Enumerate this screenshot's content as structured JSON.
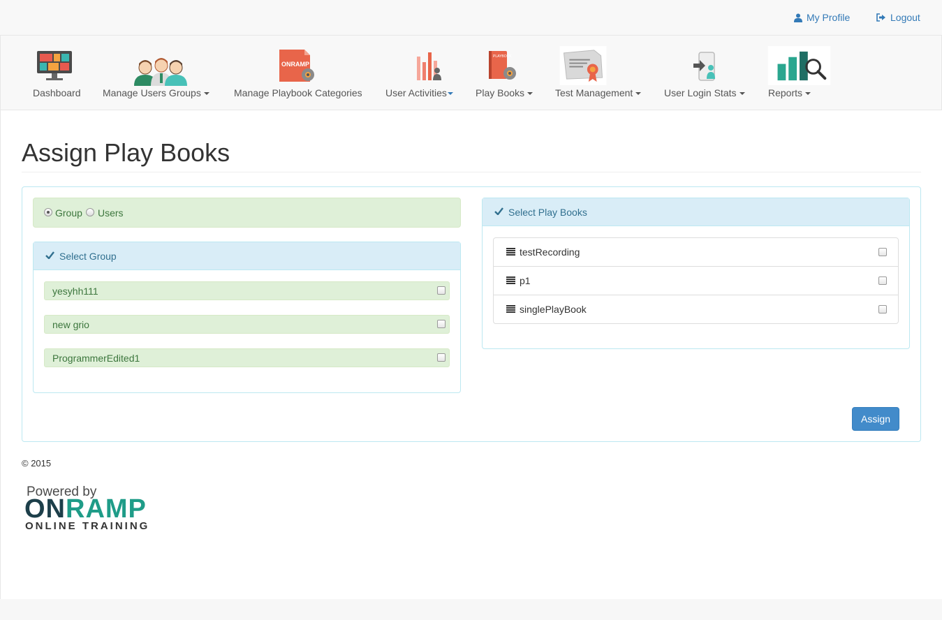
{
  "header": {
    "my_profile": "My Profile",
    "logout": "Logout"
  },
  "nav": {
    "items": [
      {
        "label": "Dashboard",
        "icon": "dashboard-monitor-icon",
        "has_caret": false
      },
      {
        "label": "Manage Users Groups",
        "icon": "users-group-icon",
        "has_caret": true
      },
      {
        "label": "Manage Playbook Categories",
        "icon": "onramp-settings-icon",
        "has_caret": false
      },
      {
        "label": "User Activities",
        "icon": "activity-bars-icon",
        "has_caret": true
      },
      {
        "label": "Play Books",
        "icon": "playbook-settings-icon",
        "has_caret": true
      },
      {
        "label": "Test Management",
        "icon": "certificate-icon",
        "has_caret": true
      },
      {
        "label": "User Login Stats",
        "icon": "login-stats-icon",
        "has_caret": true
      },
      {
        "label": "Reports",
        "icon": "reports-search-icon",
        "has_caret": true
      }
    ]
  },
  "page": {
    "title": "Assign Play Books"
  },
  "assign_type": {
    "options": [
      "Group",
      "Users"
    ],
    "selected": "Group"
  },
  "select_group": {
    "heading": "Select Group",
    "groups": [
      "yesyhh111",
      "new grio",
      "ProgrammerEdited1"
    ]
  },
  "select_playbooks": {
    "heading": "Select Play Books",
    "playbooks": [
      "testRecording",
      "p1",
      "singlePlayBook"
    ]
  },
  "actions": {
    "assign": "Assign"
  },
  "footer": {
    "copyright": "© 2015",
    "logo_powered_by": "Powered by",
    "logo_name": "ONRAMP",
    "logo_tagline": "ONLINE TRAINING"
  },
  "colors": {
    "link": "#337ab7",
    "success_bg": "#dff0d8",
    "info_bg": "#d9edf7",
    "primary_button": "#428bca",
    "brand_teal": "#1f9c88"
  }
}
